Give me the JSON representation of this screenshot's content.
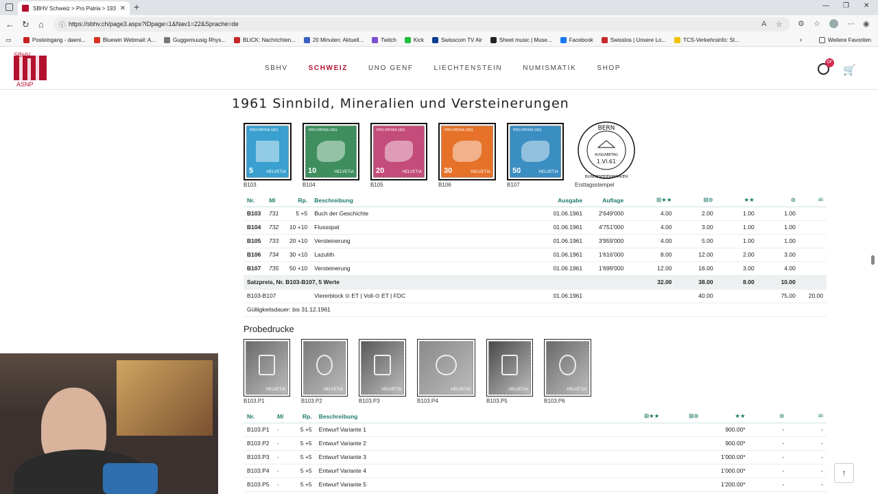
{
  "browser": {
    "tab_title": "SBHV Schweiz > Pro Patria > 193",
    "url": "https://sbhv.ch/page3.aspx?IDpage=1&Nav1=22&Sprache=de",
    "bookmarks": [
      "Posteingang - daeni...",
      "Bluewin Webmail: A...",
      "Guggemuusig Rhys...",
      "BLICK: Nachrichten...",
      "20 Minuten: Aktuell...",
      "Twitch",
      "Kick",
      "Swisscom TV Air",
      "Sheet music | Muse...",
      "Facebook",
      "Swisslos | Unsere Lo...",
      "TCS-Verkehrsinfo: St..."
    ],
    "bookmark_colors": [
      "#c5221f",
      "#d9301f",
      "#777777",
      "#c62828",
      "#3a5fc0",
      "#7b4fcf",
      "#1fbf3a",
      "#0b3e91",
      "#222222",
      "#1877f2",
      "#c62828",
      "#f2c200"
    ],
    "other_favorites": "Weitere Favoriten"
  },
  "site": {
    "logo_top": "SBHV",
    "logo_bottom": "ASNP",
    "nav": [
      "SBHV",
      "SCHWEIZ",
      "UNO GENF",
      "LIECHTENSTEIN",
      "NUMISMATIK",
      "SHOP"
    ],
    "user_badge": "DF"
  },
  "page_title": "1961 Sinnbild, Mineralien und Versteinerungen",
  "stamps": [
    {
      "code": "B103",
      "value": "5",
      "color": "#3aa0cf"
    },
    {
      "code": "B104",
      "value": "10",
      "color": "#3e8f5d"
    },
    {
      "code": "B105",
      "value": "20",
      "color": "#c44c7a"
    },
    {
      "code": "B106",
      "value": "30",
      "color": "#e6722a"
    },
    {
      "code": "B107",
      "value": "50",
      "color": "#3a8ec2"
    }
  ],
  "stamp_country": "HELVETIA",
  "stamp_header": "PRO PATRIA 1961",
  "fdc": {
    "label": "Ersttagsstempel",
    "top": "BERN",
    "bottom": "BUNDESFEIERMARKEN",
    "middle": "AUSGABETAG",
    "date": "1.VI.61"
  },
  "table1": {
    "headers": [
      "Nr.",
      "Mi",
      "Rp.",
      "Beschreibung",
      "Ausgabe",
      "Auflage",
      "⊞★★",
      "⊞⊙",
      "★★",
      "⊙",
      "✉"
    ],
    "rows": [
      [
        "B103",
        "731",
        "5 +5",
        "Buch der Geschichte",
        "01.06.1961",
        "2'649'000",
        "4.00",
        "2.00",
        "1.00",
        "1.00",
        ""
      ],
      [
        "B104",
        "732",
        "10 +10",
        "Flussspat",
        "01.06.1961",
        "4'751'000",
        "4.00",
        "3.00",
        "1.00",
        "1.00",
        ""
      ],
      [
        "B105",
        "733",
        "20 +10",
        "Versteinerung",
        "01.06.1961",
        "3'959'000",
        "4.00",
        "5.00",
        "1.00",
        "1.00",
        ""
      ],
      [
        "B106",
        "734",
        "30 +10",
        "Lazulith",
        "01.06.1961",
        "1'616'000",
        "8.00",
        "12.00",
        "2.00",
        "3.00",
        ""
      ],
      [
        "B107",
        "735",
        "50 +10",
        "Versteinerung",
        "01.06.1961",
        "1'699'000",
        "12.00",
        "16.00",
        "3.00",
        "4.00",
        ""
      ]
    ],
    "sum": {
      "label": "Satzpreis, Nr. B103-B107, 5 Werte",
      "v1": "32.00",
      "v2": "38.00",
      "v3": "8.00",
      "v4": "10.00"
    },
    "block": {
      "nr": "B103-B107",
      "desc": "Viererblock ⊙ ET | Voll-⊙ ET | FDC",
      "date": "01.06.1961",
      "v1": "40.00",
      "v2": "75.00",
      "v3": "20.00"
    },
    "validity": "Gültigkeitsdauer: bis 31.12.1961"
  },
  "probedrucke_title": "Probedrucke",
  "proofs": [
    "B103.P1",
    "B103.P2",
    "B103.P3",
    "B103.P4",
    "B103.P5",
    "B103.P6"
  ],
  "table2": {
    "headers": [
      "Nr.",
      "Mi",
      "Rp.",
      "Beschreibung",
      "⊞★★",
      "⊞⊙",
      "★★",
      "⊙",
      "✉"
    ],
    "rows": [
      [
        "B103.P1",
        "-",
        "5 +5",
        "Entwurf Variante 1",
        "",
        "",
        "900.00*",
        "-",
        "-"
      ],
      [
        "B103.P2",
        "-",
        "5 +5",
        "Entwurf Variante 2",
        "",
        "",
        "900.00*",
        "-",
        "-"
      ],
      [
        "B103.P3",
        "-",
        "5 +5",
        "Entwurf Variante 3",
        "",
        "",
        "1'000.00*",
        "-",
        "-"
      ],
      [
        "B103.P4",
        "-",
        "5 +5",
        "Entwurf Variante 4",
        "",
        "",
        "1'000.00*",
        "-",
        "-"
      ],
      [
        "B103.P5",
        "-",
        "5 +5",
        "Entwurf Variante 5",
        "",
        "",
        "1'200.00*",
        "-",
        "-"
      ]
    ]
  }
}
